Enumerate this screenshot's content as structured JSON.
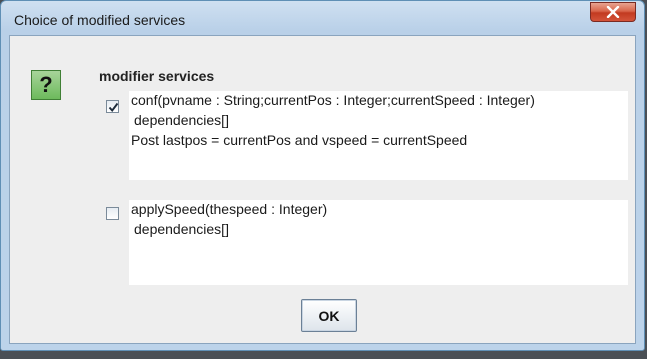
{
  "dialog": {
    "title": "Choice of modified services",
    "close_icon": "close-icon",
    "question_icon": "question-icon",
    "question_glyph": "?",
    "heading": "modifier services",
    "options": [
      {
        "checked": true,
        "lines": [
          "conf(pvname : String;currentPos : Integer;currentSpeed : Integer)",
          "dependencies[]",
          "Post lastpos = currentPos and vspeed = currentSpeed"
        ]
      },
      {
        "checked": false,
        "lines": [
          "applySpeed(thespeed : Integer)",
          "dependencies[]"
        ]
      }
    ],
    "ok_label": "OK"
  }
}
